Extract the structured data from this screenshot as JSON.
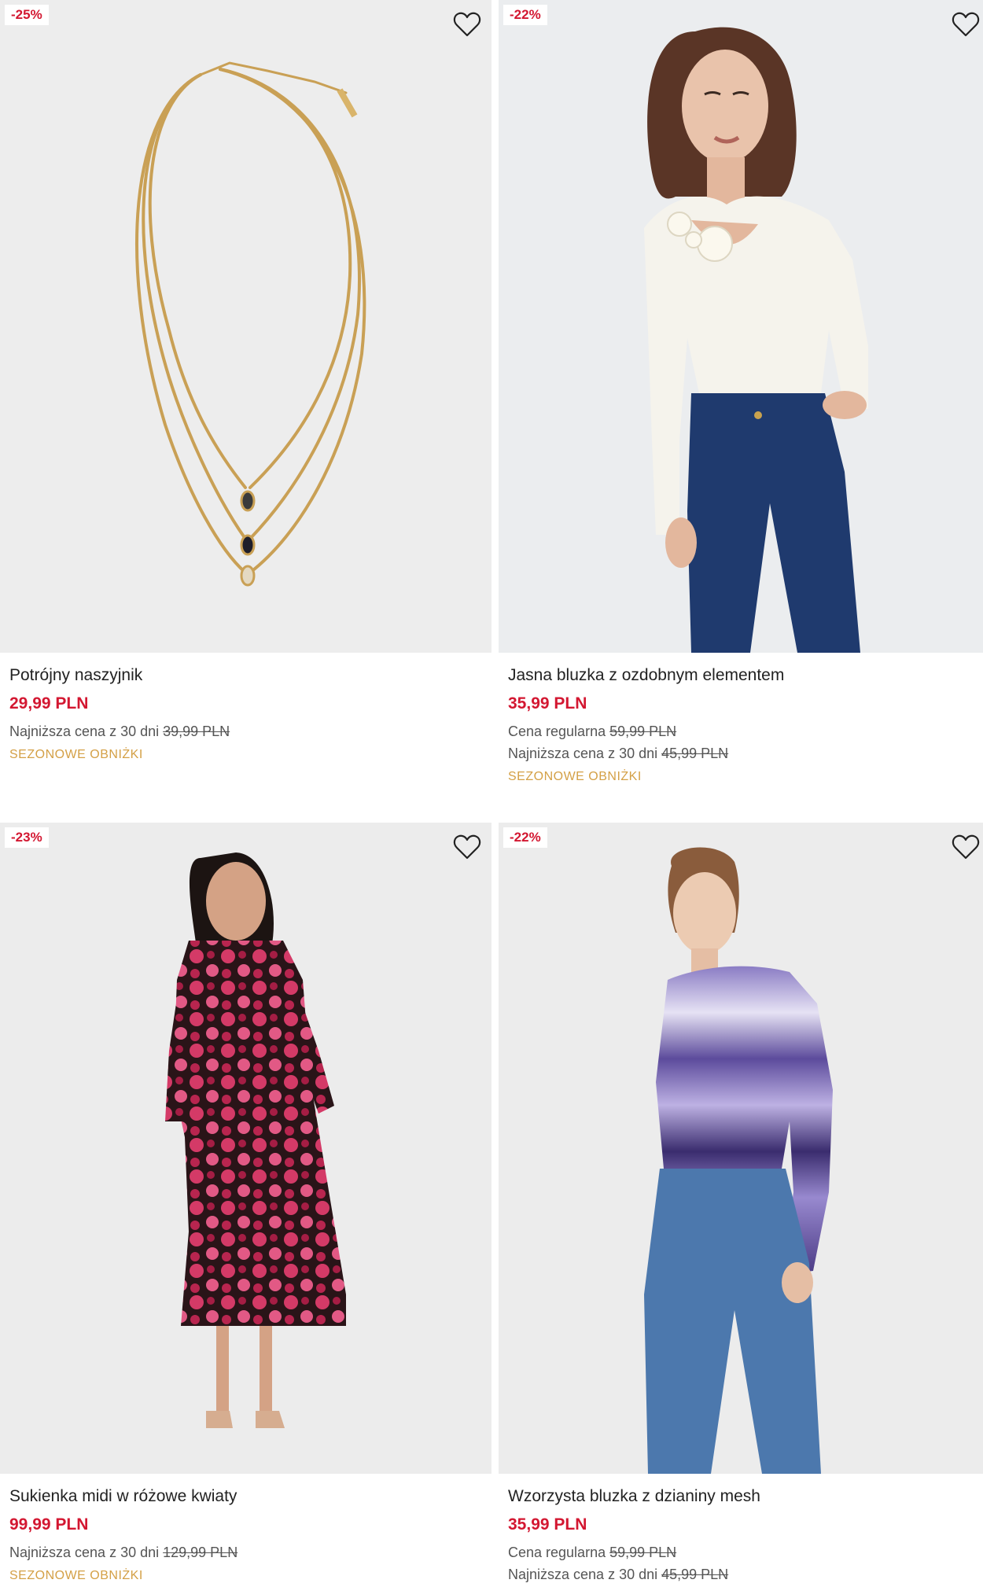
{
  "products": [
    {
      "discount": "-25%",
      "name": "Potrójny naszyjnik",
      "price": "29,99 PLN",
      "regular_label": "",
      "regular_price": "",
      "lowest_label": "Najniższa cena z 30 dni",
      "lowest_price": "39,99 PLN",
      "tag": "SEZONOWE OBNIŻKI",
      "image": "gold-triple-necklace"
    },
    {
      "discount": "-22%",
      "name": "Jasna bluzka z ozdobnym elementem",
      "price": "35,99 PLN",
      "regular_label": "Cena regularna",
      "regular_price": "59,99 PLN",
      "lowest_label": "Najniższa cena z 30 dni",
      "lowest_price": "45,99 PLN",
      "tag": "SEZONOWE OBNIŻKI",
      "image": "model-white-blouse-jeans"
    },
    {
      "discount": "-23%",
      "name": "Sukienka midi w różowe kwiaty",
      "price": "99,99 PLN",
      "regular_label": "",
      "regular_price": "",
      "lowest_label": "Najniższa cena z 30 dni",
      "lowest_price": "129,99 PLN",
      "tag": "SEZONOWE OBNIŻKI",
      "image": "model-pink-floral-dress"
    },
    {
      "discount": "-22%",
      "name": "Wzorzysta bluzka z dzianiny mesh",
      "price": "35,99 PLN",
      "regular_label": "Cena regularna",
      "regular_price": "59,99 PLN",
      "lowest_label": "Najniższa cena z 30 dni",
      "lowest_price": "45,99 PLN",
      "tag": "",
      "image": "model-purple-mesh-top"
    }
  ],
  "colors": {
    "accent_red": "#d31731",
    "tag_gold": "#d4a046",
    "image_bg": "#ececec"
  },
  "icons": {
    "wishlist": "heart-outline-icon"
  }
}
